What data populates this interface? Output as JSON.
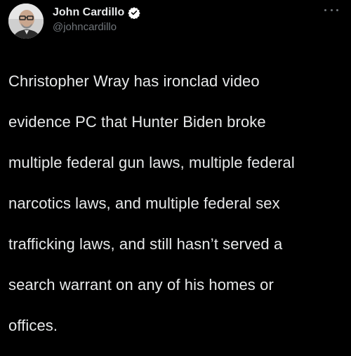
{
  "author": {
    "display_name": "John Cardillo",
    "handle": "@johncardillo",
    "verified": true,
    "avatar_icon": "profile-photo"
  },
  "tweet": {
    "text_lines": [
      "Christopher Wray has ironclad video",
      "evidence PC that Hunter Biden broke",
      "multiple federal gun laws, multiple federal",
      "narcotics laws, and multiple federal sex",
      "trafficking laws, and still hasn’t served a",
      "search warrant on any of his homes or",
      "offices."
    ]
  },
  "menu": {
    "icon": "more-horizontal-icon"
  },
  "colors": {
    "background": "#000000",
    "text_primary": "#e7e9ea",
    "text_secondary": "#71767b",
    "verified_badge": "#ffffff"
  }
}
